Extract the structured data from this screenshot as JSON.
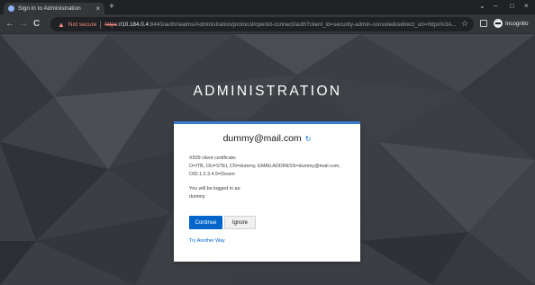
{
  "browser": {
    "tab_title": "Sign in to Administration",
    "tab_close": "×",
    "new_tab": "+",
    "window_controls": {
      "minimize": "–",
      "maximize": "□",
      "close": "×",
      "chevron": "⌄"
    },
    "nav": {
      "back": "←",
      "forward": "→",
      "reload": "C"
    },
    "security_label": "Not secure",
    "url_scheme": "https",
    "url_host": "://10.184.0.4",
    "url_rest": ":8443/auth/realms/Administration/protocol/openid-connect/auth?client_id=security-admin-console&redirect_uri=https%3A...",
    "incognito_label": "Incognito",
    "icons": {
      "warning": "warning-icon",
      "star": "star-icon",
      "sidebar": "sidebar-icon",
      "incognito": "incognito-icon"
    }
  },
  "page": {
    "realm_title": "ADMINISTRATION",
    "username": "dummy@mail.com",
    "reset_icon": "↻",
    "cert_heading": "X509 client certificate:",
    "cert_subject_line1": "O=ITB, OU=STEI, CN=dummy, EMAILADDRESS=dummy@mail.com,",
    "cert_subject_line2": "OID.1.2.3.4.5=Dosen",
    "login_as_label": "You will be logged in as:",
    "login_as_user": "dummy",
    "continue_button": "Continue",
    "ignore_button": "Ignore",
    "try_another_way": "Try Another Way"
  },
  "colors": {
    "accent": "#0066cc",
    "card_border": "#3a7bd5",
    "insecure": "#f28b82",
    "chrome_dark": "#202124",
    "chrome_toolbar": "#35363a"
  }
}
